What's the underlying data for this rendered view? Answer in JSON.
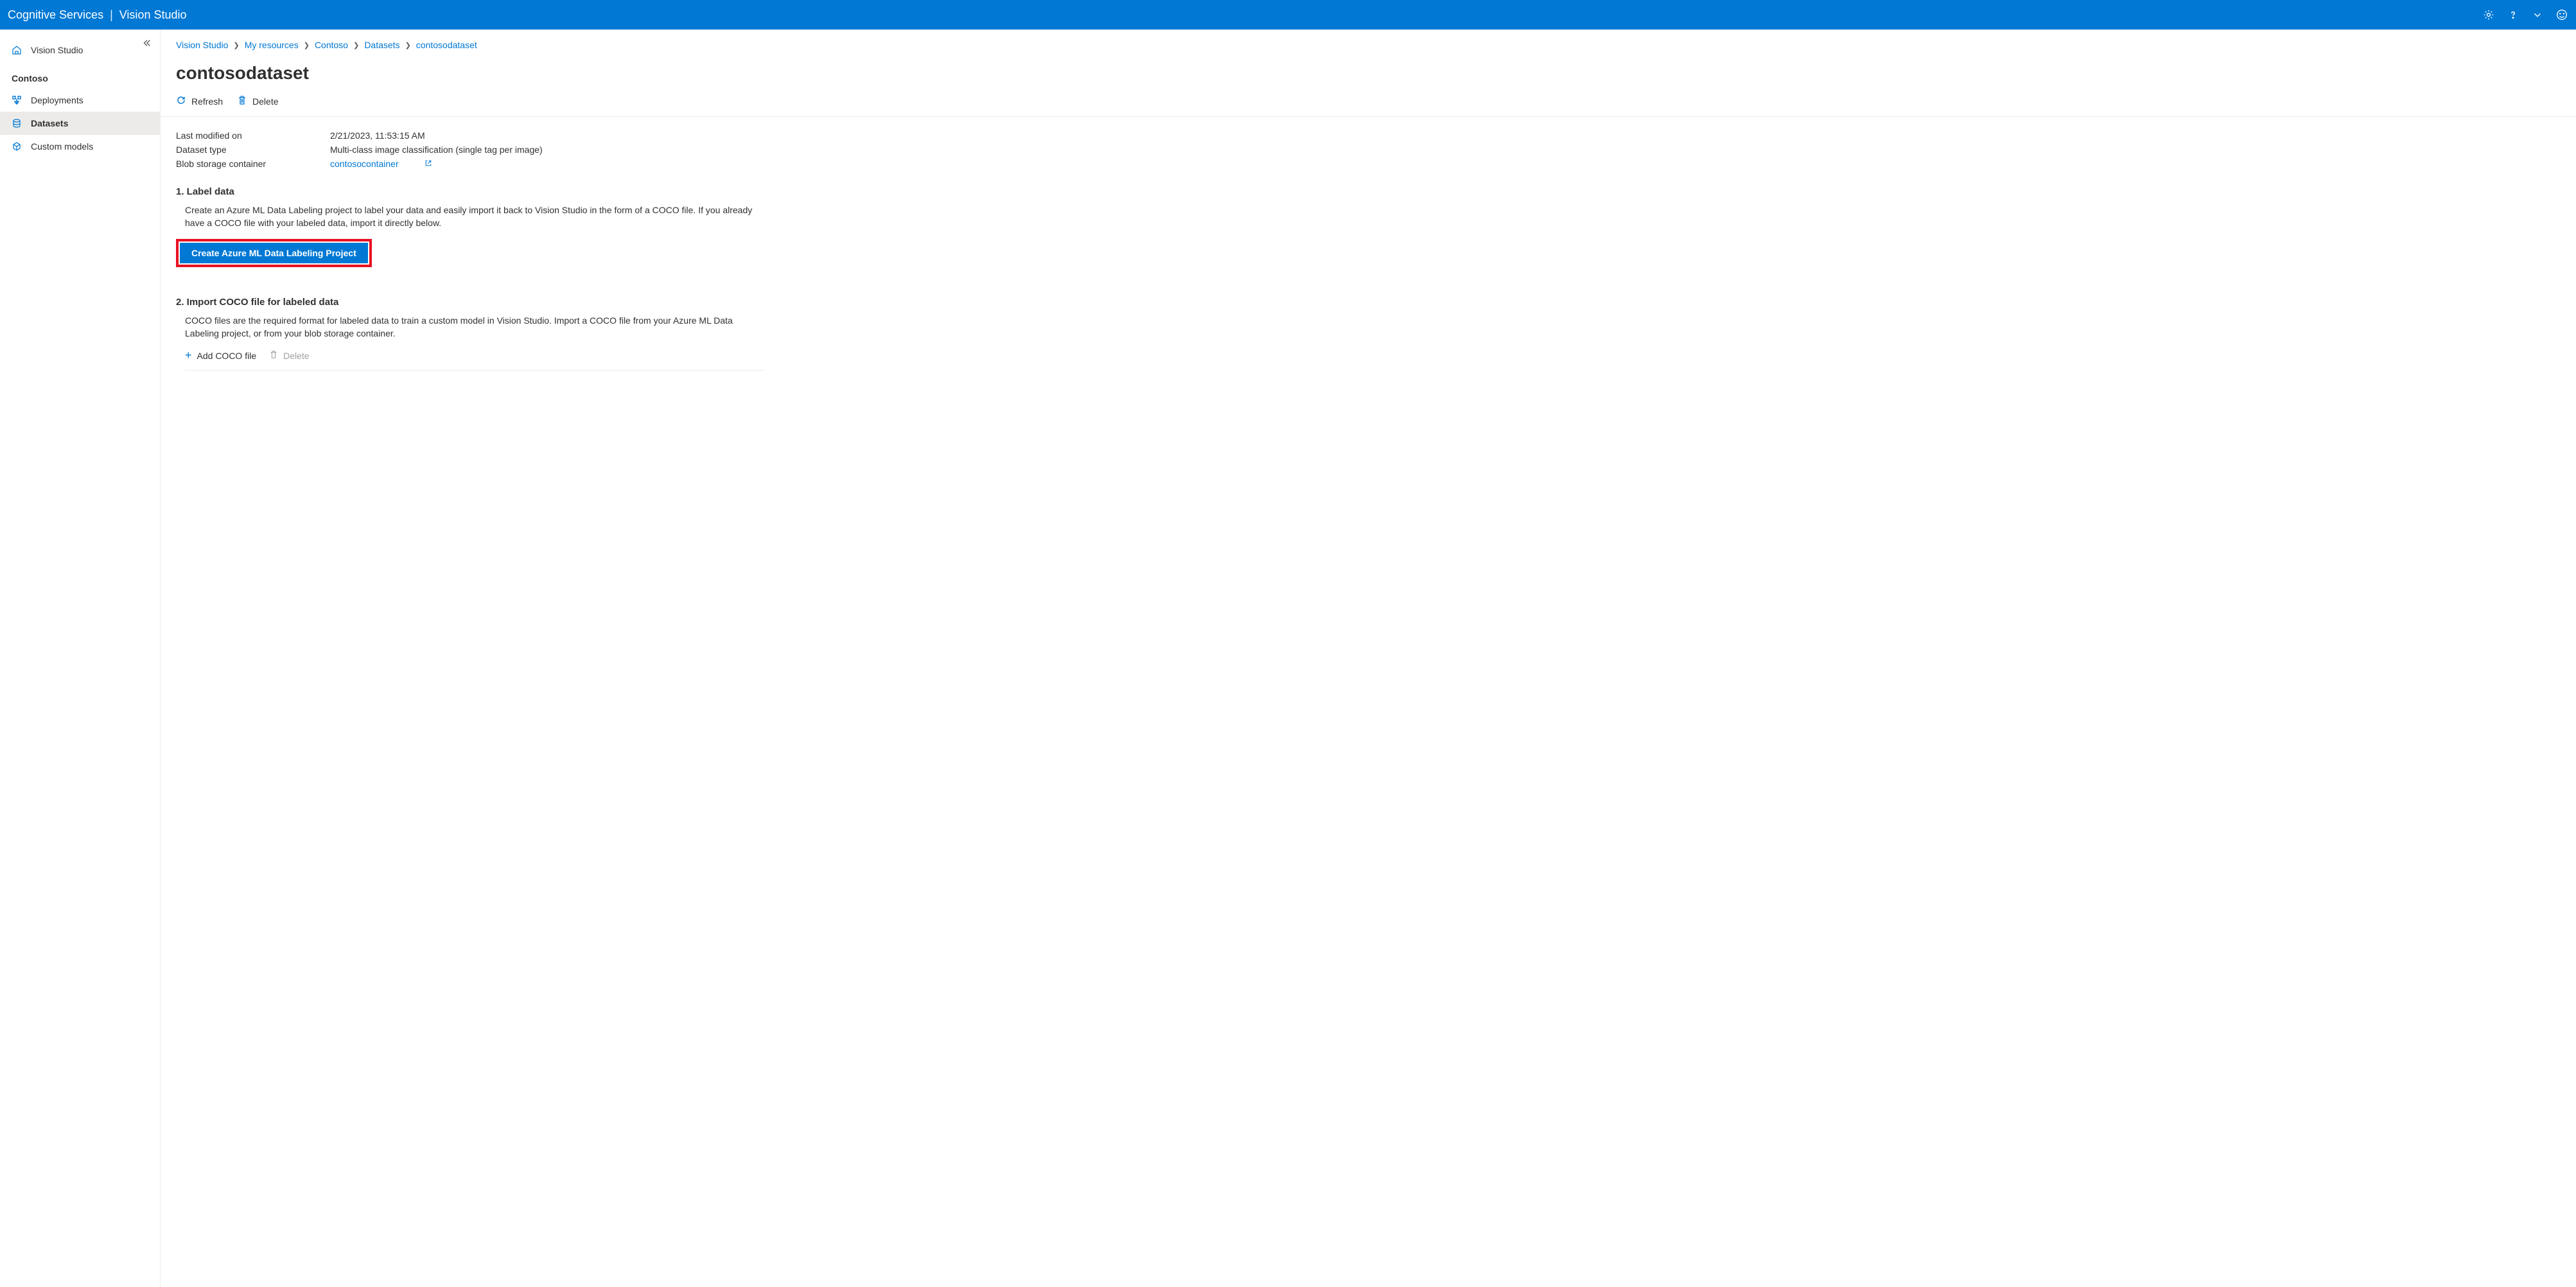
{
  "topbar": {
    "left_label": "Cognitive Services",
    "right_label": "Vision Studio"
  },
  "sidebar": {
    "home_label": "Vision Studio",
    "resource_label": "Contoso",
    "items": [
      {
        "label": "Deployments",
        "active": false
      },
      {
        "label": "Datasets",
        "active": true
      },
      {
        "label": "Custom models",
        "active": false
      }
    ]
  },
  "breadcrumb": {
    "items": [
      "Vision Studio",
      "My resources",
      "Contoso",
      "Datasets"
    ],
    "current": "contosodataset"
  },
  "page": {
    "title": "contosodataset",
    "actions": {
      "refresh": "Refresh",
      "delete": "Delete"
    },
    "meta": {
      "last_modified_label": "Last modified on",
      "last_modified_value": "2/21/2023, 11:53:15 AM",
      "dataset_type_label": "Dataset type",
      "dataset_type_value": "Multi-class image classification (single tag per image)",
      "blob_label": "Blob storage container",
      "blob_value": "contosocontainer"
    },
    "section1": {
      "title": "1. Label data",
      "desc": "Create an Azure ML Data Labeling project to label your data and easily import it back to Vision Studio in the form of a COCO file. If you already have a COCO file with your labeled data, import it directly below.",
      "button": "Create Azure ML Data Labeling Project"
    },
    "section2": {
      "title": "2. Import COCO file for labeled data",
      "desc": "COCO files are the required format for labeled data to train a custom model in Vision Studio. Import a COCO file from your Azure ML Data Labeling project, or from your blob storage container.",
      "add_label": "Add COCO file",
      "delete_label": "Delete"
    }
  }
}
